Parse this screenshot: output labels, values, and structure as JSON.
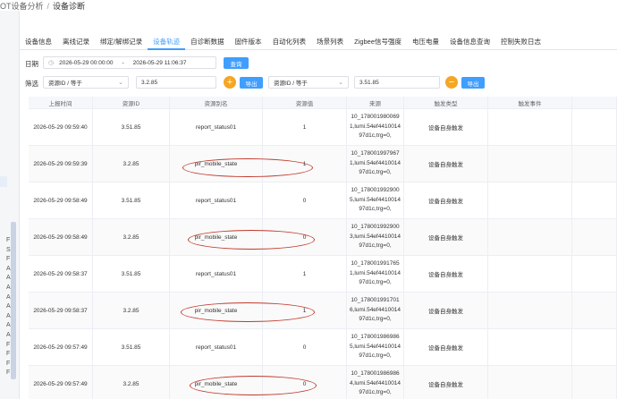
{
  "breadcrumb": {
    "parent": "OT设备分析",
    "separator": "/",
    "current": "设备诊断"
  },
  "left_strip_glyphs": [
    "F",
    "S",
    "F",
    "A",
    "A",
    "A",
    "A",
    "A",
    "A",
    "A",
    "A",
    "F",
    "F",
    "F",
    "F"
  ],
  "tabs": [
    "设备信息",
    "离线记录",
    "绑定/解绑记录",
    "设备轨迹",
    "自诊断数据",
    "固件版本",
    "自动化列表",
    "场景列表",
    "Zigbee信号强度",
    "电压电量",
    "设备信息查询",
    "控制失败日志"
  ],
  "active_tab": "设备轨迹",
  "date_filter": {
    "label": "日期",
    "calendar_icon": "clock-icon",
    "start": "2026-05-29 00:00:00",
    "range_sep": "-",
    "end": "2026-05-29 11:06:37",
    "query_label": "查询"
  },
  "filter": {
    "label": "筛选",
    "field1": "资源ID / 等于",
    "value1": "3.2.85",
    "export1": "导出",
    "field2": "资源ID / 等于",
    "value2": "3.51.85",
    "export2": "导出",
    "add_icon": "+",
    "remove_icon": "−"
  },
  "table": {
    "headers": [
      "上报时间",
      "资源ID",
      "资源别名",
      "资源值",
      "来源",
      "触发类型",
      "触发事件",
      ""
    ],
    "rows": [
      {
        "time": "2026-05-29 09:59:40",
        "res_id": "3.51.85",
        "alias": "report_status01",
        "value": "1",
        "src": [
          "10_178001980069",
          "1,lumi.54ef4410014",
          "97d1c,trg=0,"
        ],
        "trigger": "设备自身触发",
        "event": ""
      },
      {
        "time": "2026-05-29 09:59:39",
        "res_id": "3.2.85",
        "alias": "pir_mobile_state",
        "value": "1",
        "src": [
          "10_178001997967",
          "1,lumi.54ef4410014",
          "97d1c,trg=0,"
        ],
        "trigger": "设备自身触发",
        "event": ""
      },
      {
        "time": "2026-05-29 09:58:49",
        "res_id": "3.51.85",
        "alias": "report_status01",
        "value": "0",
        "src": [
          "10_178001992900",
          "5,lumi.54ef4410014",
          "97d1c,trg=0,"
        ],
        "trigger": "设备自身触发",
        "event": ""
      },
      {
        "time": "2026-05-29 09:58:49",
        "res_id": "3.2.85",
        "alias": "pir_mobile_state",
        "value": "0",
        "src": [
          "10_178001992900",
          "3,lumi.54ef4410014",
          "97d1c,trg=0,"
        ],
        "trigger": "设备自身触发",
        "event": ""
      },
      {
        "time": "2026-05-29 09:58:37",
        "res_id": "3.51.85",
        "alias": "report_status01",
        "value": "1",
        "src": [
          "10_178001991765",
          "1,lumi.54ef4410014",
          "97d1c,trg=0,"
        ],
        "trigger": "设备自身触发",
        "event": ""
      },
      {
        "time": "2026-05-29 09:58:37",
        "res_id": "3.2.85",
        "alias": "pir_mobile_state",
        "value": "1",
        "src": [
          "10_178001991701",
          "6,lumi.54ef4410014",
          "97d1c,trg=0,"
        ],
        "trigger": "设备自身触发",
        "event": ""
      },
      {
        "time": "2026-05-29 09:57:49",
        "res_id": "3.51.85",
        "alias": "report_status01",
        "value": "0",
        "src": [
          "10_178001986986",
          "5,lumi.54ef4410014",
          "97d1c,trg=0,"
        ],
        "trigger": "设备自身触发",
        "event": ""
      },
      {
        "time": "2026-05-29 09:57:49",
        "res_id": "3.2.85",
        "alias": "pir_mobile_state",
        "value": "0",
        "src": [
          "10_178001986986",
          "4,lumi.54ef4410014",
          "97d1c,trg=0,"
        ],
        "trigger": "设备自身触发",
        "event": ""
      }
    ]
  },
  "colors": {
    "accent": "#409eff",
    "orange": "#f5a623",
    "annotation": "#c0392b"
  }
}
